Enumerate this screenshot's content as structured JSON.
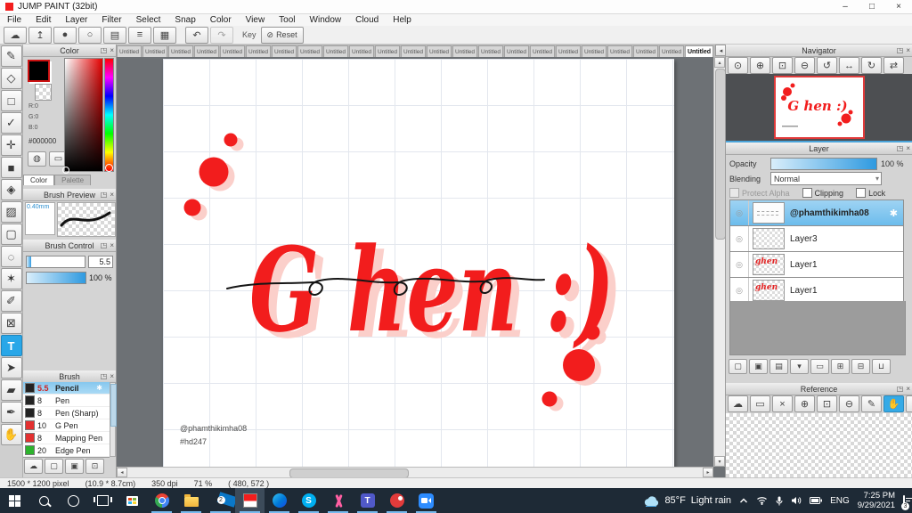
{
  "theme": {
    "red": "#f21d1d",
    "pink": "#fbcfca",
    "taskbar": "#1e2a36",
    "selection": "#29a7e8"
  },
  "window": {
    "title": "JUMP PAINT (32bit)",
    "controls": {
      "minimize": "–",
      "maximize": "□",
      "close": "×"
    }
  },
  "icons": {
    "panel_popout": "◳",
    "panel_close": "×",
    "dropdown": "▾",
    "up": "▴",
    "down": "▾",
    "left": "◂",
    "right": "▸",
    "eye": "◎",
    "gear": "✱"
  },
  "menu": {
    "items": [
      "File",
      "Edit",
      "Layer",
      "Filter",
      "Select",
      "Snap",
      "Color",
      "View",
      "Tool",
      "Window",
      "Cloud",
      "Help"
    ]
  },
  "toolbar": {
    "key_label": "Key",
    "reset_label": "Reset",
    "reset_icon": "⊘",
    "buttons": [
      {
        "name": "cloud-button",
        "glyph": "☁"
      },
      {
        "name": "publish-button",
        "glyph": "↥"
      },
      {
        "name": "comment-filled-button",
        "glyph": "●"
      },
      {
        "name": "comment-outline-button",
        "glyph": "○"
      },
      {
        "name": "document-button",
        "glyph": "▤"
      },
      {
        "name": "settings-list-button",
        "glyph": "≡"
      },
      {
        "name": "palette-grid-button",
        "glyph": "▦"
      }
    ],
    "history": [
      {
        "name": "undo-button",
        "glyph": "↶"
      },
      {
        "name": "redo-button",
        "glyph": "↷",
        "cls": "disabled"
      }
    ]
  },
  "tools": {
    "items": [
      {
        "name": "pen-tool",
        "glyph": "✎"
      },
      {
        "name": "eraser-tool",
        "glyph": "◇"
      },
      {
        "name": "rect-tool",
        "glyph": "□"
      },
      {
        "name": "curve-tool",
        "glyph": "✓"
      },
      {
        "name": "move-tool",
        "glyph": "✛"
      },
      {
        "name": "shape-tool",
        "glyph": "■"
      },
      {
        "name": "fill-tool",
        "glyph": "◈"
      },
      {
        "name": "gradient-tool",
        "glyph": "▨"
      },
      {
        "name": "marquee-select-tool",
        "glyph": "▢"
      },
      {
        "name": "lasso-tool",
        "glyph": "◌"
      },
      {
        "name": "magic-wand-tool",
        "glyph": "✶"
      },
      {
        "name": "select-pen-tool",
        "glyph": "✐"
      },
      {
        "name": "select-eraser-tool",
        "glyph": "⊠"
      },
      {
        "name": "text-tool",
        "glyph": "T",
        "cls": "active"
      },
      {
        "name": "object-select-tool",
        "glyph": "➤"
      },
      {
        "name": "soft-eraser-tool",
        "glyph": "▰"
      },
      {
        "name": "eyedropper-tool",
        "glyph": "✒"
      },
      {
        "name": "hand-tool",
        "glyph": "✋"
      }
    ]
  },
  "tabs": {
    "items": [
      "Untitled",
      "Untitled",
      "Untitled",
      "Untitled",
      "Untitled",
      "Untitled",
      "Untitled",
      "Untitled",
      "Untitled",
      "Untitled",
      "Untitled",
      "Untitled",
      "Untitled",
      "Untitled",
      "Untitled",
      "Untitled",
      "Untitled",
      "Untitled",
      "Untitled",
      "Untitled",
      "Untitled",
      "Untitled"
    ],
    "active": "Untitled"
  },
  "color_panel": {
    "title": "Color",
    "r": "R:0",
    "g": "G:0",
    "b": "B:0",
    "hex": "#000000",
    "tab_color": "Color",
    "tab_palette": "Palette",
    "wheel_icon": "◍",
    "mode_icon": "▭"
  },
  "brush_preview": {
    "title": "Brush Preview",
    "size_label": "0.40mm"
  },
  "brush_control": {
    "title": "Brush Control",
    "size_value": "5.5",
    "opacity_value": "100 %"
  },
  "brush_panel": {
    "title": "Brush",
    "items": [
      {
        "name": "brush-pencil",
        "size": "5.5",
        "label": "Pencil",
        "color": "#222222",
        "cls": "selected"
      },
      {
        "name": "brush-pen",
        "size": "8",
        "label": "Pen",
        "color": "#222222"
      },
      {
        "name": "brush-pen-sharp",
        "size": "8",
        "label": "Pen (Sharp)",
        "color": "#222222"
      },
      {
        "name": "brush-g-pen",
        "size": "10",
        "label": "G Pen",
        "color": "#e33030"
      },
      {
        "name": "brush-mapping-pen",
        "size": "8",
        "label": "Mapping Pen",
        "color": "#e33030"
      },
      {
        "name": "brush-edge-pen",
        "size": "20",
        "label": "Edge Pen",
        "color": "#2db32d"
      }
    ],
    "footer": [
      {
        "name": "brush-cloud-button",
        "glyph": "☁"
      },
      {
        "name": "brush-new-button",
        "glyph": "▢"
      },
      {
        "name": "brush-save-button",
        "glyph": "▣"
      },
      {
        "name": "brush-script-button",
        "glyph": "⊡"
      }
    ]
  },
  "navigator": {
    "title": "Navigator",
    "buttons": [
      {
        "name": "nav-zoom-tool-button",
        "glyph": "⊙"
      },
      {
        "name": "nav-zoom-in-button",
        "glyph": "⊕"
      },
      {
        "name": "nav-fit-button",
        "glyph": "⊡"
      },
      {
        "name": "nav-zoom-out-button",
        "glyph": "⊖"
      },
      {
        "name": "nav-rotate-left-button",
        "glyph": "↺"
      },
      {
        "name": "nav-fit-width-button",
        "glyph": "↔"
      },
      {
        "name": "nav-reset-rotation-button",
        "glyph": "↻"
      },
      {
        "name": "nav-flip-button",
        "glyph": "⇄"
      }
    ]
  },
  "layer_panel": {
    "title": "Layer",
    "opacity_label": "Opacity",
    "opacity_value": "100 %",
    "blending_label": "Blending",
    "blending_value": "Normal",
    "protect_alpha_label": "Protect Alpha",
    "clipping_label": "Clipping",
    "lock_label": "Lock",
    "layers": [
      {
        "name": "layer-phamthikimha08",
        "label": "@phamthikimha08",
        "cls": "selected thumb-user"
      },
      {
        "name": "layer-3",
        "label": "Layer3"
      },
      {
        "name": "layer-1a",
        "label": "Layer1",
        "cls": "thumb-art",
        "thumb_text": "ghen"
      },
      {
        "name": "layer-1b",
        "label": "Layer1",
        "cls": "thumb-art",
        "thumb_text": "ghen"
      }
    ],
    "footer": [
      {
        "name": "add-layer-button",
        "glyph": "▢"
      },
      {
        "name": "add-8bit-layer-button",
        "glyph": "▣"
      },
      {
        "name": "add-1bit-layer-button",
        "glyph": "▤"
      },
      {
        "name": "layer-type-dropdown",
        "glyph": "▾"
      },
      {
        "name": "add-folder-button",
        "glyph": "▭"
      },
      {
        "name": "duplicate-layer-button",
        "glyph": "⊞"
      },
      {
        "name": "merge-layer-button",
        "glyph": "⊟"
      },
      {
        "name": "delete-layer-button",
        "glyph": "⊔"
      }
    ]
  },
  "reference": {
    "title": "Reference",
    "buttons": [
      {
        "name": "ref-cloud-button",
        "glyph": "☁"
      },
      {
        "name": "ref-open-button",
        "glyph": "▭"
      },
      {
        "name": "ref-close-button",
        "glyph": "×"
      },
      {
        "name": "ref-zoom-in-button",
        "glyph": "⊕"
      },
      {
        "name": "ref-fit-button",
        "glyph": "⊡"
      },
      {
        "name": "ref-zoom-out-button",
        "glyph": "⊖"
      },
      {
        "name": "ref-draw-button",
        "glyph": "✎"
      },
      {
        "name": "ref-hand-button",
        "glyph": "✋",
        "cls": "active"
      },
      {
        "name": "ref-rotate-button",
        "glyph": "↻"
      }
    ]
  },
  "canvas": {
    "artwork_text": "G hen :)",
    "watermark1": "@phamthikimha08",
    "watermark2": "#hd247"
  },
  "status": {
    "size": "1500 * 1200 pixel",
    "cm": "(10.9 * 8.7cm)",
    "dpi": "350 dpi",
    "zoom": "71 %",
    "coords": "( 480, 572 )"
  },
  "taskbar": {
    "weather_temp": "85°F",
    "weather_cond": "Light rain",
    "lang": "ENG",
    "time": "7:25 PM",
    "date": "9/29/2021",
    "mail_badge": "2",
    "notif_badge": "3",
    "skype_letter": "S",
    "teams_letter": "T"
  }
}
